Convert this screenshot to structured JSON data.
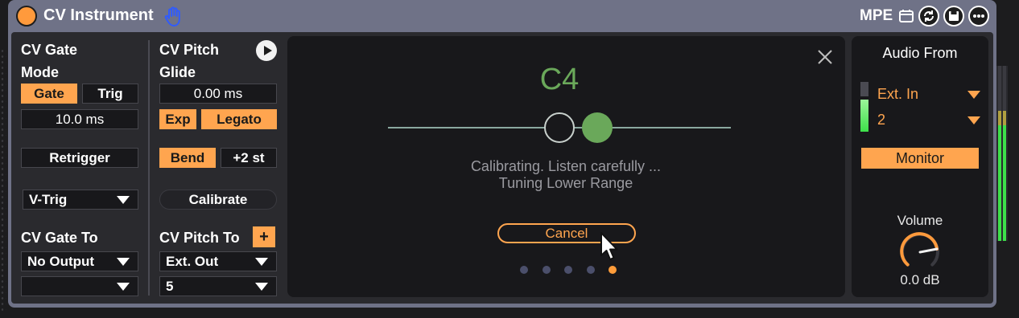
{
  "device": {
    "title": "CV Instrument",
    "mpe_label": "MPE"
  },
  "gate": {
    "section_label": "CV Gate",
    "mode_label": "Mode",
    "gate_button": "Gate",
    "trig_button": "Trig",
    "time_value": "10.0 ms",
    "retrigger_button": "Retrigger",
    "trigger_type": "V-Trig",
    "gate_to_label": "CV Gate To",
    "gate_to_value": "No Output",
    "gate_to_channel": ""
  },
  "pitch": {
    "section_label": "CV Pitch",
    "glide_label": "Glide",
    "glide_value": "0.00 ms",
    "exp_button": "Exp",
    "legato_button": "Legato",
    "bend_button": "Bend",
    "bend_range": "+2 st",
    "calibrate_button": "Calibrate",
    "pitch_to_label": "CV Pitch To",
    "add_button": "+",
    "pitch_to_value": "Ext. Out",
    "pitch_to_channel": "5"
  },
  "calibration": {
    "note": "C4",
    "status_line1": "Calibrating. Listen carefully ...",
    "status_line2": "Tuning Lower Range",
    "cancel_button": "Cancel",
    "pages_total": 5,
    "page_active": 5
  },
  "audio": {
    "section_label": "Audio From",
    "input_value": "Ext. In",
    "channel_value": "2",
    "monitor_button": "Monitor",
    "volume_label": "Volume",
    "volume_value": "0.0 dB"
  },
  "colors": {
    "accent_orange": "#ffa54f",
    "pitch_green": "#6aa85a",
    "meter_green": "#3de04a"
  },
  "icons": {
    "device_on": "power-icon",
    "hand": "hand-icon",
    "mpe": "mpe-toggle-icon",
    "refresh": "refresh-icon",
    "save": "save-icon",
    "more": "more-icon",
    "play": "play-icon",
    "close": "close-icon",
    "cursor": "cursor-icon"
  }
}
